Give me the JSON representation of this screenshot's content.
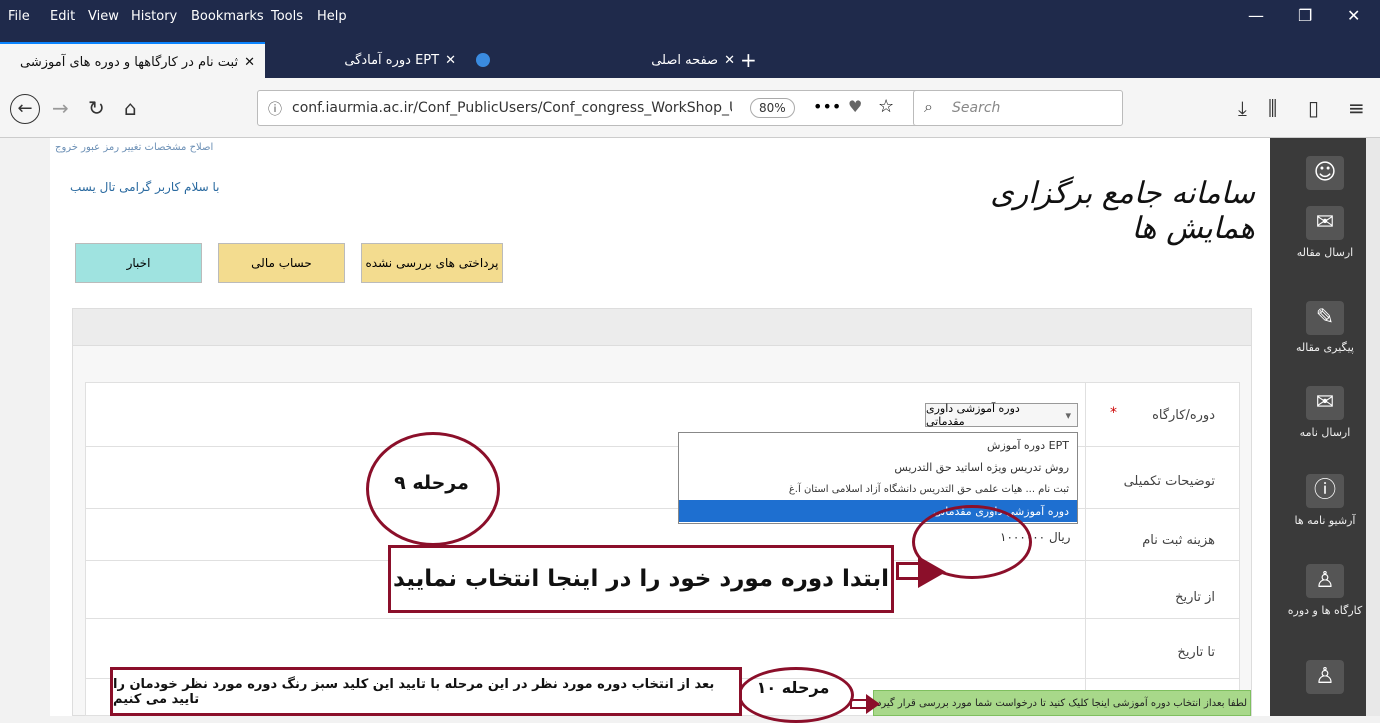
{
  "menubar": {
    "items": [
      "File",
      "Edit",
      "View",
      "History",
      "Bookmarks",
      "Tools",
      "Help"
    ],
    "window_controls": [
      "—",
      "❐",
      "✕"
    ]
  },
  "tabs": [
    {
      "label": "ثبت نام در کارگاهها و دوره های آموزشی",
      "close": "✕"
    },
    {
      "label": "دوره آمادگی EPT",
      "close": "✕"
    },
    {
      "label": "صفحه اصلی",
      "close": "✕"
    }
  ],
  "new_tab_symbol": "+",
  "nav": {
    "url": "conf.iaurmia.ac.ir/Conf_PublicUsers/Conf_congress_WorkShop_Us",
    "zoom": "80%",
    "search_placeholder": "Search"
  },
  "page": {
    "top_links": "اصلاح مشخصات   تغییر رمز عبور   خروج",
    "greeting": "با سلام کاربر گرامی  تال یسب",
    "site_title": "سامانه جامع برگزاری همایش ها",
    "buttons": {
      "unverified": "پرداختی های بررسی نشده",
      "finance": "حساب مالی",
      "news": "اخبار"
    },
    "form": {
      "course_label": "دوره/کارگاه",
      "required_mark": "*",
      "course_selected": "دوره آموزشی داوری مقدماتی",
      "desc_label": "توضیحات تکمیلی",
      "fee_label": "هزینه ثبت نام",
      "fee_value": "۱۰۰۰۰۰۰ ریال",
      "from_label": "از تاریخ",
      "to_label": "تا تاریخ"
    },
    "dropdown_options": [
      "دوره آموزش EPT",
      "روش تدریس ویژه اساتید حق التدریس",
      "ثبت نام ... هیات علمی حق التدریس دانشگاه آزاد اسلامی استان آ.غ",
      "دوره آموزشی داوری مقدماتی"
    ],
    "submit_green": "لطفا بعداز انتخاب دوره آموزشی اینجا کلیک کنید تا درخواست شما مورد بررسی قرار گیرد"
  },
  "annotations": {
    "step9": "مرحله ۹",
    "step10": "مرحله ۱۰",
    "instruction1": "ابتدا دوره مورد خود را در اینجا انتخاب نمایید",
    "instruction2": "بعد از انتخاب دوره مورد نظر در این مرحله با تایید این کلید سبز رنگ دوره مورد نظر خودمان را تایید می کنیم"
  },
  "sidebar": [
    {
      "label": "",
      "icon": "user-icon"
    },
    {
      "label": "ارسال مقاله",
      "icon": "send-icon"
    },
    {
      "label": "پیگیری مقاله",
      "icon": "track-icon"
    },
    {
      "label": "ارسال نامه",
      "icon": "mail-icon"
    },
    {
      "label": "آرشیو نامه ها",
      "icon": "archive-icon"
    },
    {
      "label": "کارگاه ها و دوره",
      "icon": "workshop-icon"
    }
  ]
}
